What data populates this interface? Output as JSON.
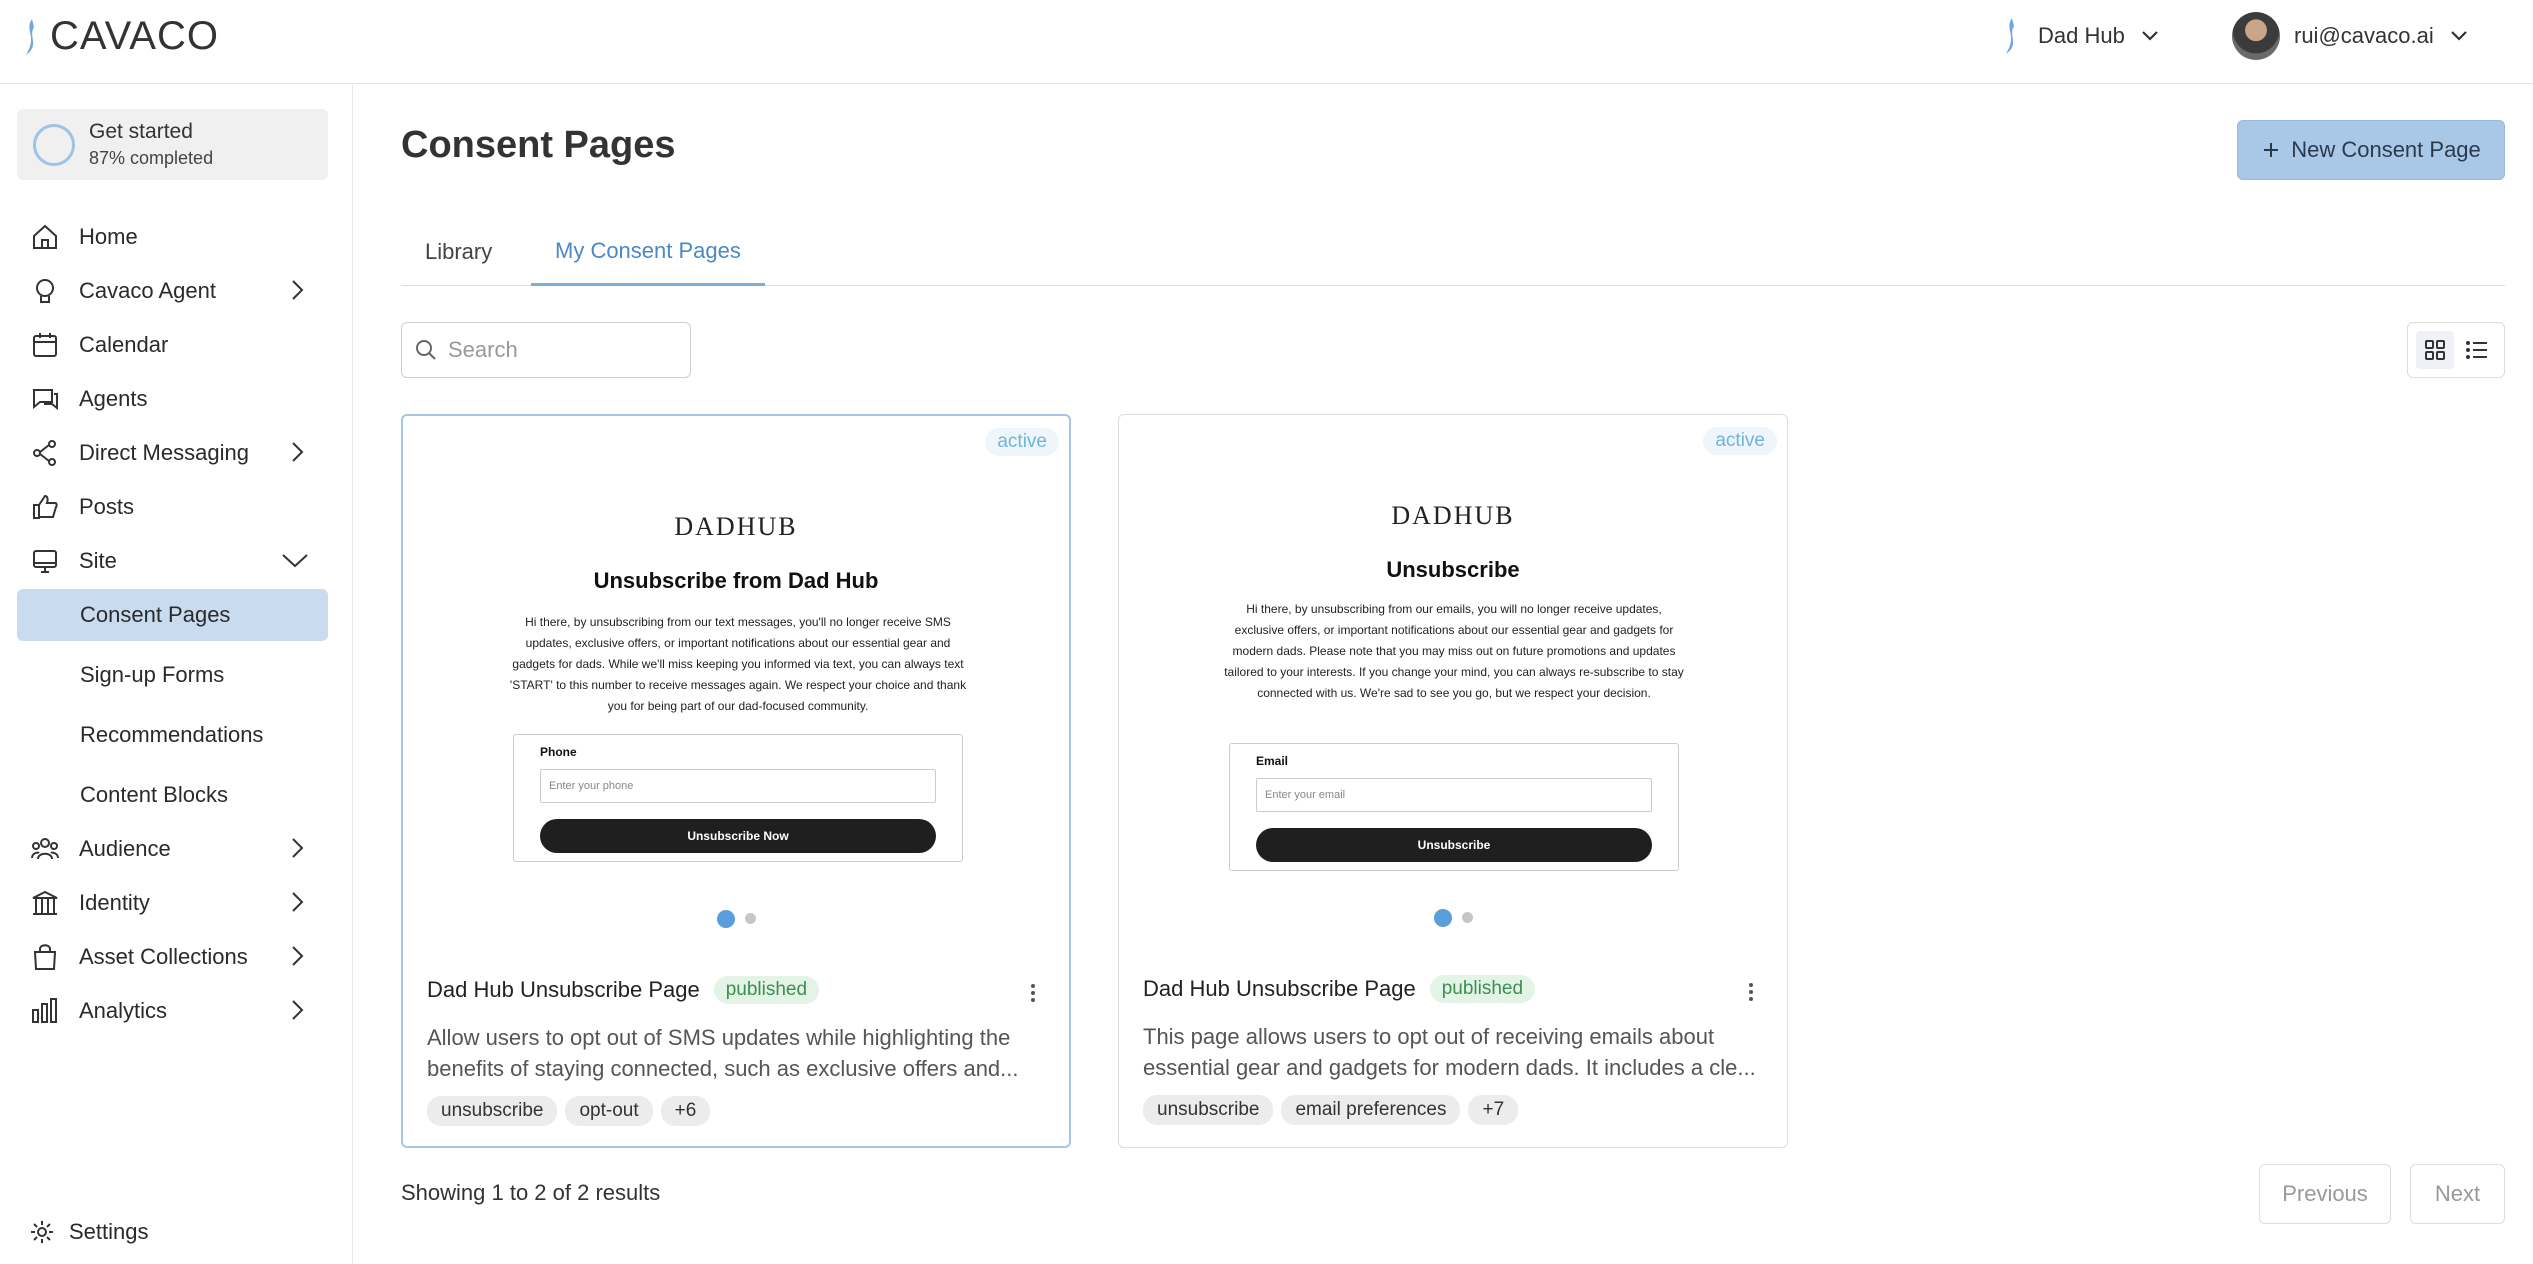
{
  "brand": {
    "logo_text": "CAVACO"
  },
  "workspace": {
    "name": "Dad Hub"
  },
  "user": {
    "email": "rui@cavaco.ai"
  },
  "get_started": {
    "title": "Get started",
    "progress_text": "87% completed",
    "progress": 0.87
  },
  "sidebar": {
    "items": [
      {
        "label": "Home",
        "icon": "home-icon"
      },
      {
        "label": "Cavaco Agent",
        "icon": "lightbulb-icon"
      },
      {
        "label": "Calendar",
        "icon": "calendar-icon"
      },
      {
        "label": "Agents",
        "icon": "chat-icon"
      },
      {
        "label": "Direct Messaging",
        "icon": "share-icon"
      },
      {
        "label": "Posts",
        "icon": "thumbs-up-icon"
      },
      {
        "label": "Site",
        "icon": "monitor-icon"
      },
      {
        "label": "Audience",
        "icon": "people-icon"
      },
      {
        "label": "Identity",
        "icon": "building-icon"
      },
      {
        "label": "Asset Collections",
        "icon": "bag-icon"
      },
      {
        "label": "Analytics",
        "icon": "bar-chart-icon"
      }
    ],
    "site_sub": [
      {
        "label": "Consent Pages"
      },
      {
        "label": "Sign-up Forms"
      },
      {
        "label": "Recommendations"
      },
      {
        "label": "Content Blocks"
      }
    ],
    "settings_label": "Settings"
  },
  "page": {
    "title": "Consent Pages",
    "new_button": "New Consent Page",
    "tabs": [
      {
        "label": "Library"
      },
      {
        "label": "My Consent Pages"
      }
    ],
    "search_placeholder": "Search",
    "results_text": "Showing 1 to 2 of 2 results",
    "prev_label": "Previous",
    "next_label": "Next"
  },
  "cards": [
    {
      "status": "active",
      "preview_logo": "DADHUB",
      "preview_title": "Unsubscribe from Dad Hub",
      "preview_body": "Hi there, by unsubscribing from our text messages, you'll no longer receive SMS updates, exclusive offers, or important notifications about our essential gear and gadgets for dads. While we'll miss keeping you informed via text, you can always text 'START' to this number to receive messages again. We respect your choice and thank you for being part of our dad-focused community.",
      "field_label": "Phone",
      "field_placeholder": "Enter your phone",
      "button_label": "Unsubscribe Now",
      "name": "Dad Hub Unsubscribe Page",
      "state": "published",
      "description": "Allow users to opt out of SMS updates while highlighting the benefits of staying connected, such as exclusive offers and...",
      "tags": [
        "unsubscribe",
        "opt-out",
        "+6"
      ]
    },
    {
      "status": "active",
      "preview_logo": "DADHUB",
      "preview_title": "Unsubscribe",
      "preview_body": "Hi there, by unsubscribing from our emails, you will no longer receive updates, exclusive offers, or important notifications about our essential gear and gadgets for modern dads. Please note that you may miss out on future promotions and updates tailored to your interests. If you change your mind, you can always re-subscribe to stay connected with us. We're sad to see you go, but we respect your decision.",
      "field_label": "Email",
      "field_placeholder": "Enter your email",
      "button_label": "Unsubscribe",
      "name": "Dad Hub Unsubscribe Page",
      "state": "published",
      "description": "This page allows users to opt out of receiving emails about essential gear and gadgets for modern dads. It includes a cle...",
      "tags": [
        "unsubscribe",
        "email preferences",
        "+7"
      ]
    }
  ],
  "colors": {
    "accent": "#4a88c7",
    "active_nav": "#c9dbef",
    "primary_button": "#a9c8e8"
  }
}
